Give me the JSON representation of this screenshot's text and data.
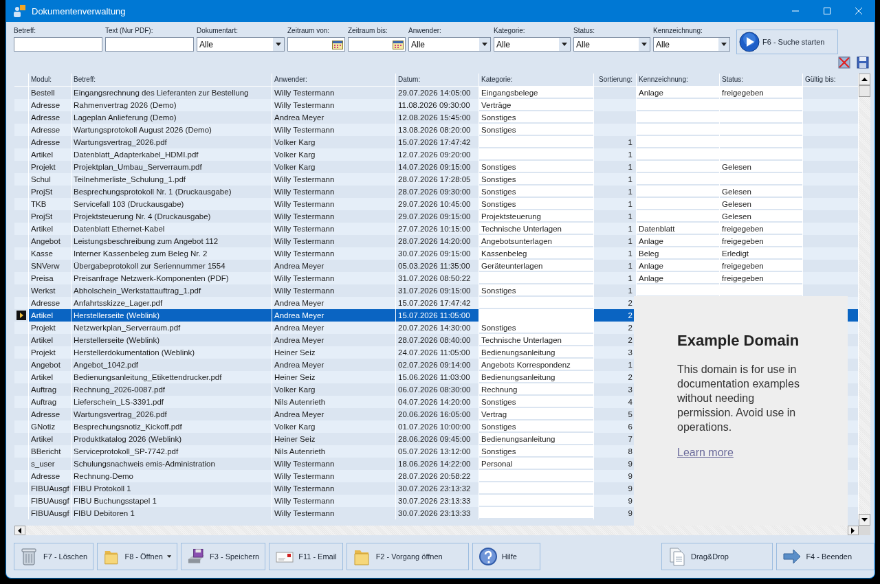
{
  "window": {
    "title": "Dokumentenverwaltung"
  },
  "filters": [
    {
      "label": "Betreff:",
      "kind": "text"
    },
    {
      "label": "Text (Nur PDF):",
      "kind": "text"
    },
    {
      "label": "Dokumentart:",
      "kind": "combo",
      "value": "Alle"
    },
    {
      "label": "Zeitraum von:",
      "kind": "date"
    },
    {
      "label": "Zeitraum bis:",
      "kind": "date"
    },
    {
      "label": "Anwender:",
      "kind": "combo",
      "value": "Alle"
    },
    {
      "label": "Kategorie:",
      "kind": "combo",
      "value": "Alle"
    },
    {
      "label": "Status:",
      "kind": "combo",
      "value": "Alle"
    },
    {
      "label": "Kennzeichnung:",
      "kind": "combo",
      "value": "Alle"
    }
  ],
  "search_button": {
    "label": "F6 - Suche starten"
  },
  "table": {
    "columns": [
      {
        "label": "Modul:",
        "kind": "text"
      },
      {
        "label": "Betreff:",
        "kind": "text"
      },
      {
        "label": "Anwender:",
        "kind": "text"
      },
      {
        "label": "Datum:",
        "kind": "text"
      },
      {
        "label": "Kategorie:",
        "kind": "edit"
      },
      {
        "label": "Sortierung:",
        "kind": "number"
      },
      {
        "label": "Kennzeichnung:",
        "kind": "edit"
      },
      {
        "label": "Status:",
        "kind": "edit"
      },
      {
        "label": "Gültig bis:",
        "kind": "text"
      }
    ],
    "rows": [
      {
        "modul": "Bestell",
        "betreff": "Eingangsrechnung des Lieferanten zur Bestellung",
        "anwender": "Willy Testermann",
        "datum": "29.07.2026 14:05:00",
        "kategorie": "Eingangsbelege",
        "kennzeichnung": "Anlage",
        "status": "freigegeben",
        "selected": false
      },
      {
        "modul": "Adresse",
        "betreff": "Rahmenvertrag 2026 (Demo)",
        "anwender": "Willy Testermann",
        "datum": "11.08.2026 09:30:00",
        "kategorie": "Verträge",
        "selected": false
      },
      {
        "modul": "Adresse",
        "betreff": "Lageplan Anlieferung (Demo)",
        "anwender": "Andrea Meyer",
        "datum": "12.08.2026 15:45:00",
        "kategorie": "Sonstiges",
        "selected": false
      },
      {
        "modul": "Adresse",
        "betreff": "Wartungsprotokoll August 2026 (Demo)",
        "anwender": "Willy Testermann",
        "datum": "13.08.2026 08:20:00",
        "kategorie": "Sonstiges",
        "selected": false
      },
      {
        "modul": "Adresse",
        "betreff": "Wartungsvertrag_2026.pdf",
        "anwender": "Volker Karg",
        "datum": "15.07.2026 17:47:42",
        "sortierung": "1",
        "selected": false
      },
      {
        "modul": "Artikel",
        "betreff": "Datenblatt_Adapterkabel_HDMI.pdf",
        "anwender": "Volker Karg",
        "datum": "12.07.2026 09:20:00",
        "sortierung": "1",
        "selected": false
      },
      {
        "modul": "Projekt",
        "betreff": "Projektplan_Umbau_Serverraum.pdf",
        "anwender": "Volker Karg",
        "datum": "14.07.2026 09:15:00",
        "kategorie": "Sonstiges",
        "sortierung": "1",
        "status": "Gelesen",
        "selected": false
      },
      {
        "modul": "Schul",
        "betreff": "Teilnehmerliste_Schulung_1.pdf",
        "anwender": "Willy Testermann",
        "datum": "28.07.2026 17:28:05",
        "kategorie": "Sonstiges",
        "sortierung": "1",
        "selected": false
      },
      {
        "modul": "ProjSt",
        "betreff": "Besprechungsprotokoll Nr. 1 (Druckausgabe)",
        "anwender": "Willy Testermann",
        "datum": "28.07.2026 09:30:00",
        "kategorie": "Sonstiges",
        "sortierung": "1",
        "status": "Gelesen",
        "selected": false
      },
      {
        "modul": "TKB",
        "betreff": "Servicefall 103 (Druckausgabe)",
        "anwender": "Willy Testermann",
        "datum": "29.07.2026 10:45:00",
        "kategorie": "Sonstiges",
        "sortierung": "1",
        "status": "Gelesen",
        "selected": false
      },
      {
        "modul": "ProjSt",
        "betreff": "Projektsteuerung Nr. 4 (Druckausgabe)",
        "anwender": "Willy Testermann",
        "datum": "29.07.2026 09:15:00",
        "kategorie": "Projektsteuerung",
        "sortierung": "1",
        "status": "Gelesen",
        "selected": false
      },
      {
        "modul": "Artikel",
        "betreff": "Datenblatt Ethernet-Kabel",
        "anwender": "Willy Testermann",
        "datum": "27.07.2026 10:15:00",
        "kategorie": "Technische Unterlagen",
        "sortierung": "1",
        "kennzeichnung": "Datenblatt",
        "status": "freigegeben",
        "selected": false
      },
      {
        "modul": "Angebot",
        "betreff": "Leistungsbeschreibung zum Angebot 112",
        "anwender": "Willy Testermann",
        "datum": "28.07.2026 14:20:00",
        "kategorie": "Angebotsunterlagen",
        "sortierung": "1",
        "kennzeichnung": "Anlage",
        "status": "freigegeben",
        "selected": false
      },
      {
        "modul": "Kasse",
        "betreff": "Interner Kassenbeleg zum Beleg Nr. 2",
        "anwender": "Willy Testermann",
        "datum": "30.07.2026 09:15:00",
        "kategorie": "Kassenbeleg",
        "sortierung": "1",
        "kennzeichnung": "Beleg",
        "status": "Erledigt",
        "selected": false
      },
      {
        "modul": "SNVerw",
        "betreff": "Übergabeprotokoll zur Seriennummer 1554",
        "anwender": "Andrea Meyer",
        "datum": "05.03.2026 11:35:00",
        "kategorie": "Geräteunterlagen",
        "sortierung": "1",
        "kennzeichnung": "Anlage",
        "status": "freigegeben",
        "selected": false
      },
      {
        "modul": "Preisa",
        "betreff": "Preisanfrage Netzwerk-Komponenten (PDF)",
        "anwender": "Willy Testermann",
        "datum": "31.07.2026 08:50:22",
        "sortierung": "1",
        "kennzeichnung": "Anlage",
        "status": "freigegeben",
        "selected": false
      },
      {
        "modul": "Werkst",
        "betreff": "Abholschein_Werkstattauftrag_1.pdf",
        "anwender": "Willy Testermann",
        "datum": "31.07.2026 09:15:00",
        "kategorie": "Sonstiges",
        "sortierung": "1",
        "selected": false
      },
      {
        "modul": "Adresse",
        "betreff": "Anfahrtsskizze_Lager.pdf",
        "anwender": "Andrea Meyer",
        "datum": "15.07.2026 17:47:42",
        "sortierung": "2",
        "selected": false
      },
      {
        "modul": "Artikel",
        "betreff": "Herstellerseite (Weblink)",
        "anwender": "Andrea Meyer",
        "datum": "15.07.2026 11:05:00",
        "sortierung": "2",
        "selected": true
      },
      {
        "modul": "Projekt",
        "betreff": "Netzwerkplan_Serverraum.pdf",
        "anwender": "Andrea Meyer",
        "datum": "20.07.2026 14:30:00",
        "kategorie": "Sonstiges",
        "sortierung": "2",
        "selected": false
      },
      {
        "modul": "Artikel",
        "betreff": "Herstellerseite (Weblink)",
        "anwender": "Andrea Meyer",
        "datum": "28.07.2026 08:40:00",
        "kategorie": "Technische Unterlagen",
        "sortierung": "2",
        "selected": false
      },
      {
        "modul": "Projekt",
        "betreff": "Herstellerdokumentation (Weblink)",
        "anwender": "Heiner Seiz",
        "datum": "24.07.2026 11:05:00",
        "kategorie": "Bedienungsanleitung",
        "sortierung": "3",
        "selected": false
      },
      {
        "modul": "Angebot",
        "betreff": "Angebot_1042.pdf",
        "anwender": "Andrea Meyer",
        "datum": "02.07.2026 09:14:00",
        "kategorie": "Angebots Korrespondenz",
        "sortierung": "1",
        "selected": false
      },
      {
        "modul": "Artikel",
        "betreff": "Bedienungsanleitung_Etikettendrucker.pdf",
        "anwender": "Heiner Seiz",
        "datum": "15.06.2026 11:03:00",
        "kategorie": "Bedienungsanleitung",
        "sortierung": "2",
        "selected": false
      },
      {
        "modul": "Auftrag",
        "betreff": "Rechnung_2026-0087.pdf",
        "anwender": "Volker Karg",
        "datum": "06.07.2026 08:30:00",
        "kategorie": "Rechnung",
        "sortierung": "3",
        "selected": false
      },
      {
        "modul": "Auftrag",
        "betreff": "Lieferschein_LS-3391.pdf",
        "anwender": "Nils Autenrieth",
        "datum": "04.07.2026 14:20:00",
        "kategorie": "Sonstiges",
        "sortierung": "4",
        "selected": false
      },
      {
        "modul": "Adresse",
        "betreff": "Wartungsvertrag_2026.pdf",
        "anwender": "Andrea Meyer",
        "datum": "20.06.2026 16:05:00",
        "kategorie": "Vertrag",
        "sortierung": "5",
        "selected": false
      },
      {
        "modul": "GNotiz",
        "betreff": "Besprechungsnotiz_Kickoff.pdf",
        "anwender": "Volker Karg",
        "datum": "01.07.2026 10:00:00",
        "kategorie": "Sonstiges",
        "sortierung": "6",
        "selected": false
      },
      {
        "modul": "Artikel",
        "betreff": "Produktkatalog 2026 (Weblink)",
        "anwender": "Heiner Seiz",
        "datum": "28.06.2026 09:45:00",
        "kategorie": "Bedienungsanleitung",
        "sortierung": "7",
        "selected": false
      },
      {
        "modul": "BBericht",
        "betreff": "Serviceprotokoll_SP-7742.pdf",
        "anwender": "Nils Autenrieth",
        "datum": "05.07.2026 13:12:00",
        "kategorie": "Sonstiges",
        "sortierung": "8",
        "selected": false
      },
      {
        "modul": "s_user",
        "betreff": "Schulungsnachweis emis-Administration",
        "anwender": "Willy Testermann",
        "datum": "18.06.2026 14:22:00",
        "kategorie": "Personal",
        "sortierung": "9",
        "selected": false
      },
      {
        "modul": "Adresse",
        "betreff": "Rechnung-Demo",
        "anwender": "Willy Testermann",
        "datum": "28.07.2026 20:58:22",
        "sortierung": "9",
        "selected": false
      },
      {
        "modul": "FIBUAusgf",
        "betreff": "FIBU Protokoll 1",
        "anwender": "Willy Testermann",
        "datum": "30.07.2026 23:13:32",
        "sortierung": "9",
        "selected": false
      },
      {
        "modul": "FIBUAusgf",
        "betreff": "FIBU Buchungsstapel 1",
        "anwender": "Willy Testermann",
        "datum": "30.07.2026 23:13:33",
        "sortierung": "9",
        "selected": false
      },
      {
        "modul": "FIBUAusgf",
        "betreff": "FIBU Debitoren 1",
        "anwender": "Willy Testermann",
        "datum": "30.07.2026 23:13:33",
        "sortierung": "9",
        "selected": false
      }
    ]
  },
  "preview": {
    "heading": "Example Domain",
    "text": "This domain is for use in documentation examples without needing permission. Avoid use in operations.",
    "link": "Learn more"
  },
  "buttons": [
    {
      "label": "F7 - Löschen",
      "kind": "trash",
      "menu": false
    },
    {
      "label": "F8 - Öffnen",
      "kind": "folder",
      "menu": true
    },
    {
      "label": "F3 - Speichern",
      "kind": "disk",
      "menu": false
    },
    {
      "label": "F11 - Email",
      "kind": "mail",
      "menu": false
    },
    {
      "label": "F2 - Vorgang öffnen",
      "kind": "folder",
      "menu": false
    },
    {
      "label": "Hilfe",
      "kind": "help",
      "menu": false
    },
    {
      "label": "Drag&Drop",
      "kind": "documents",
      "menu": false
    },
    {
      "label": "F4 - Beenden",
      "kind": "arrow",
      "menu": false
    }
  ]
}
